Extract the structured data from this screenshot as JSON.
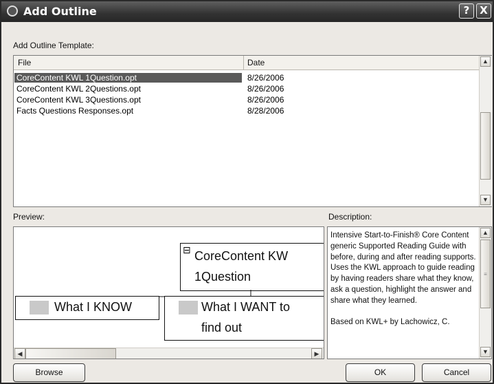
{
  "window": {
    "title": "Add Outline",
    "help_btn": "?",
    "close_btn": "X"
  },
  "template_label": "Add Outline Template:",
  "list": {
    "columns": {
      "file": "File",
      "date": "Date"
    },
    "rows": [
      {
        "file": "CoreContent KWL 1Question.opt",
        "date": "8/26/2006",
        "selected": true
      },
      {
        "file": "CoreContent KWL 2Questions.opt",
        "date": "8/26/2006",
        "selected": false
      },
      {
        "file": "CoreContent KWL 3Questions.opt",
        "date": "8/26/2006",
        "selected": false
      },
      {
        "file": "Facts Questions Responses.opt",
        "date": "8/28/2006",
        "selected": false
      }
    ]
  },
  "preview": {
    "label": "Preview:",
    "root_expander": "⊟",
    "root_line1": "CoreContent KW",
    "root_line2": "1Question",
    "child1": "What I KNOW",
    "child2_line1": "What I WANT to",
    "child2_line2": "find out"
  },
  "description": {
    "label": "Description:",
    "text": "Intensive Start-to-Finish® Core Content generic Supported Reading Guide with before, during and after reading supports. Uses the KWL approach to guide reading by having readers share what they know, ask a question, highlight the answer and share what they learned.",
    "text2": "Based on KWL+ by Lachowicz, C."
  },
  "buttons": {
    "browse": "Browse",
    "ok": "OK",
    "cancel": "Cancel"
  },
  "scroll_glyphs": {
    "up": "▲",
    "down": "▼",
    "left": "◀",
    "right": "▶",
    "grip": "≡"
  },
  "colors": {
    "title_bg": "#323232",
    "selection_bg": "#5a5a5a",
    "dialog_bg": "#ece9e4"
  }
}
